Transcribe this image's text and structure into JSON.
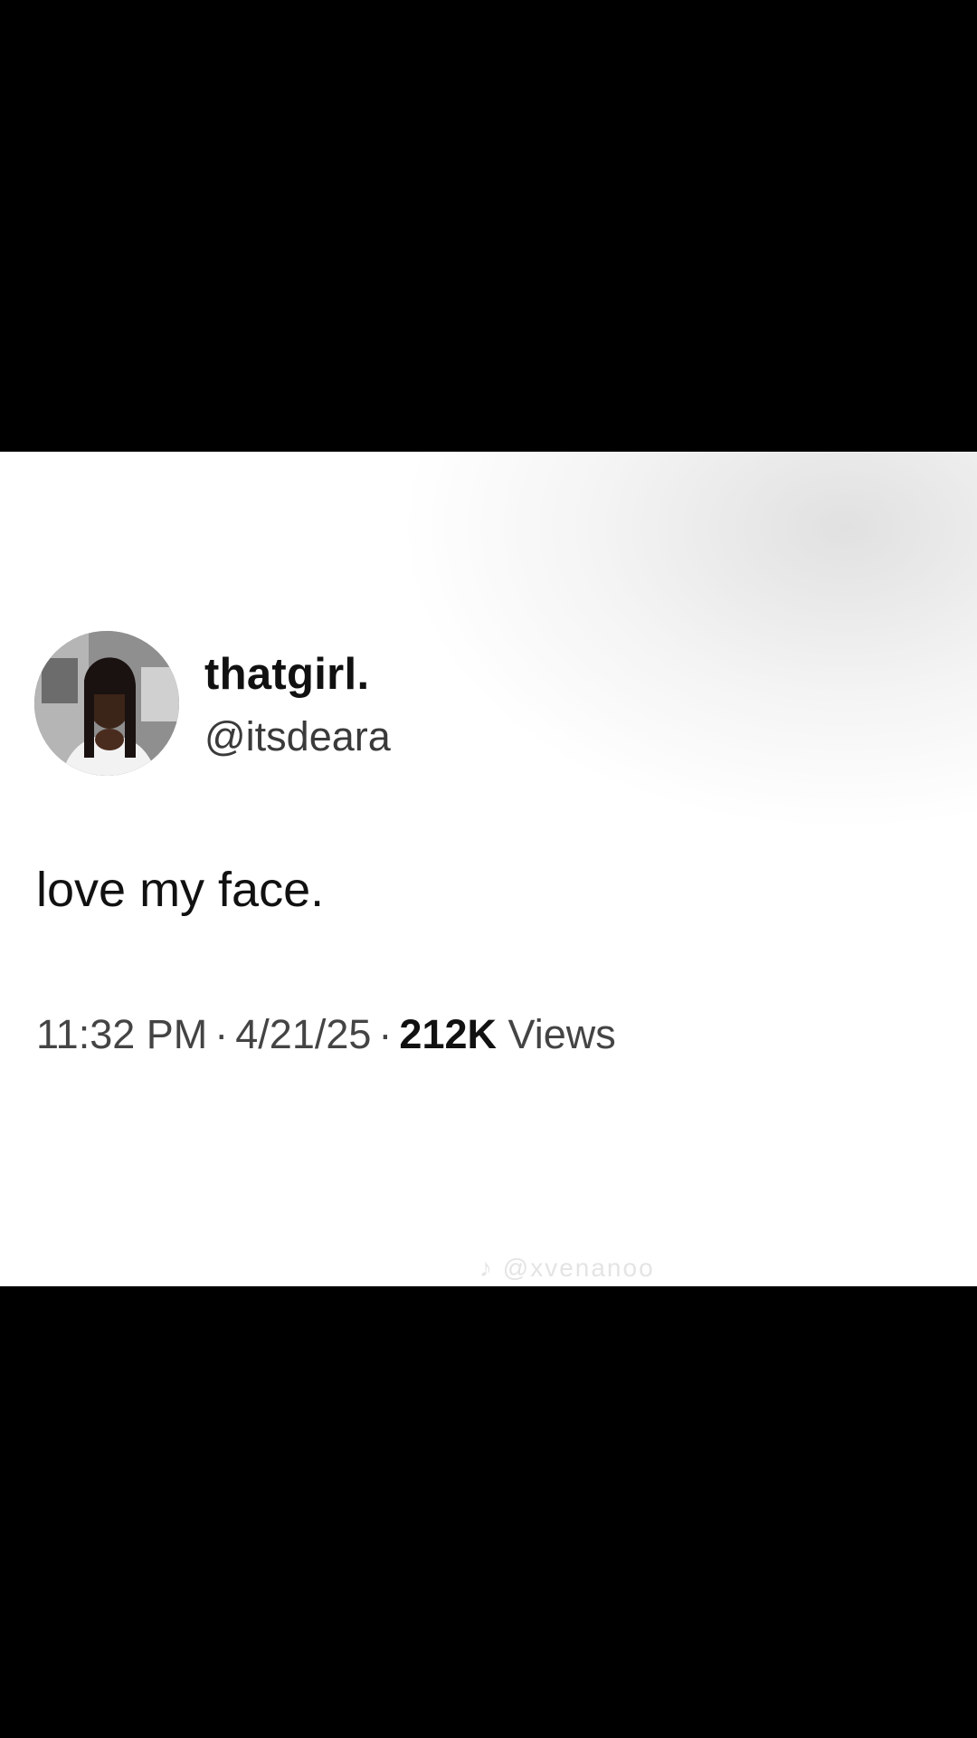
{
  "tweet": {
    "display_name": "thatgirl.",
    "handle": "@itsdeara",
    "text": "love my face.",
    "time": "11:32 PM",
    "separator": "·",
    "date": "4/21/25",
    "views_count": "212K",
    "views_label": "Views"
  },
  "watermark": {
    "text": "♪ @xvenanoo"
  },
  "colors": {
    "background": "#000000",
    "card": "#ffffff",
    "text_primary": "#111111",
    "text_secondary": "#444444"
  }
}
